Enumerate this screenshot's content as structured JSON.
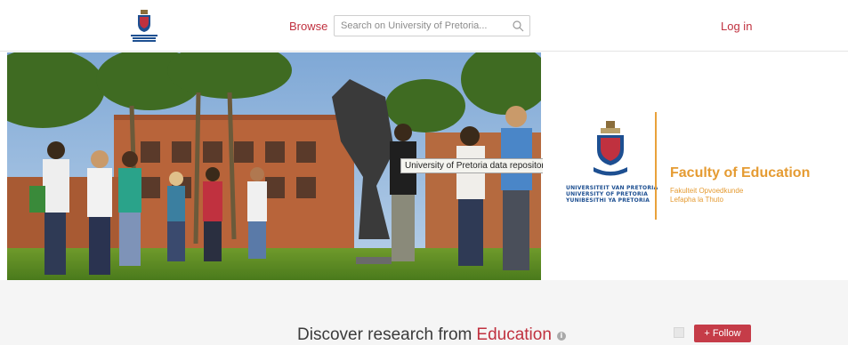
{
  "header": {
    "browse_label": "Browse",
    "search_placeholder": "Search on University of Pretoria...",
    "login_label": "Log in"
  },
  "banner": {
    "photo_tooltip": "University of Pretoria data repository",
    "university_lines": [
      "UNIVERSITEIT VAN PRETORIA",
      "UNIVERSITY OF PRETORIA",
      "YUNIBESITHI YA PRETORIA"
    ],
    "faculty_title": "Faculty of Education",
    "faculty_sub_1": "Fakulteit Opvoedkunde",
    "faculty_sub_2": "Lefapha la Thuto"
  },
  "discover": {
    "prefix": "Discover research from",
    "group": "Education"
  },
  "follow_label": "+ Follow",
  "colors": {
    "brand_red": "#c0313f",
    "faculty_orange": "#e59b32",
    "uni_blue": "#1d4f91"
  }
}
